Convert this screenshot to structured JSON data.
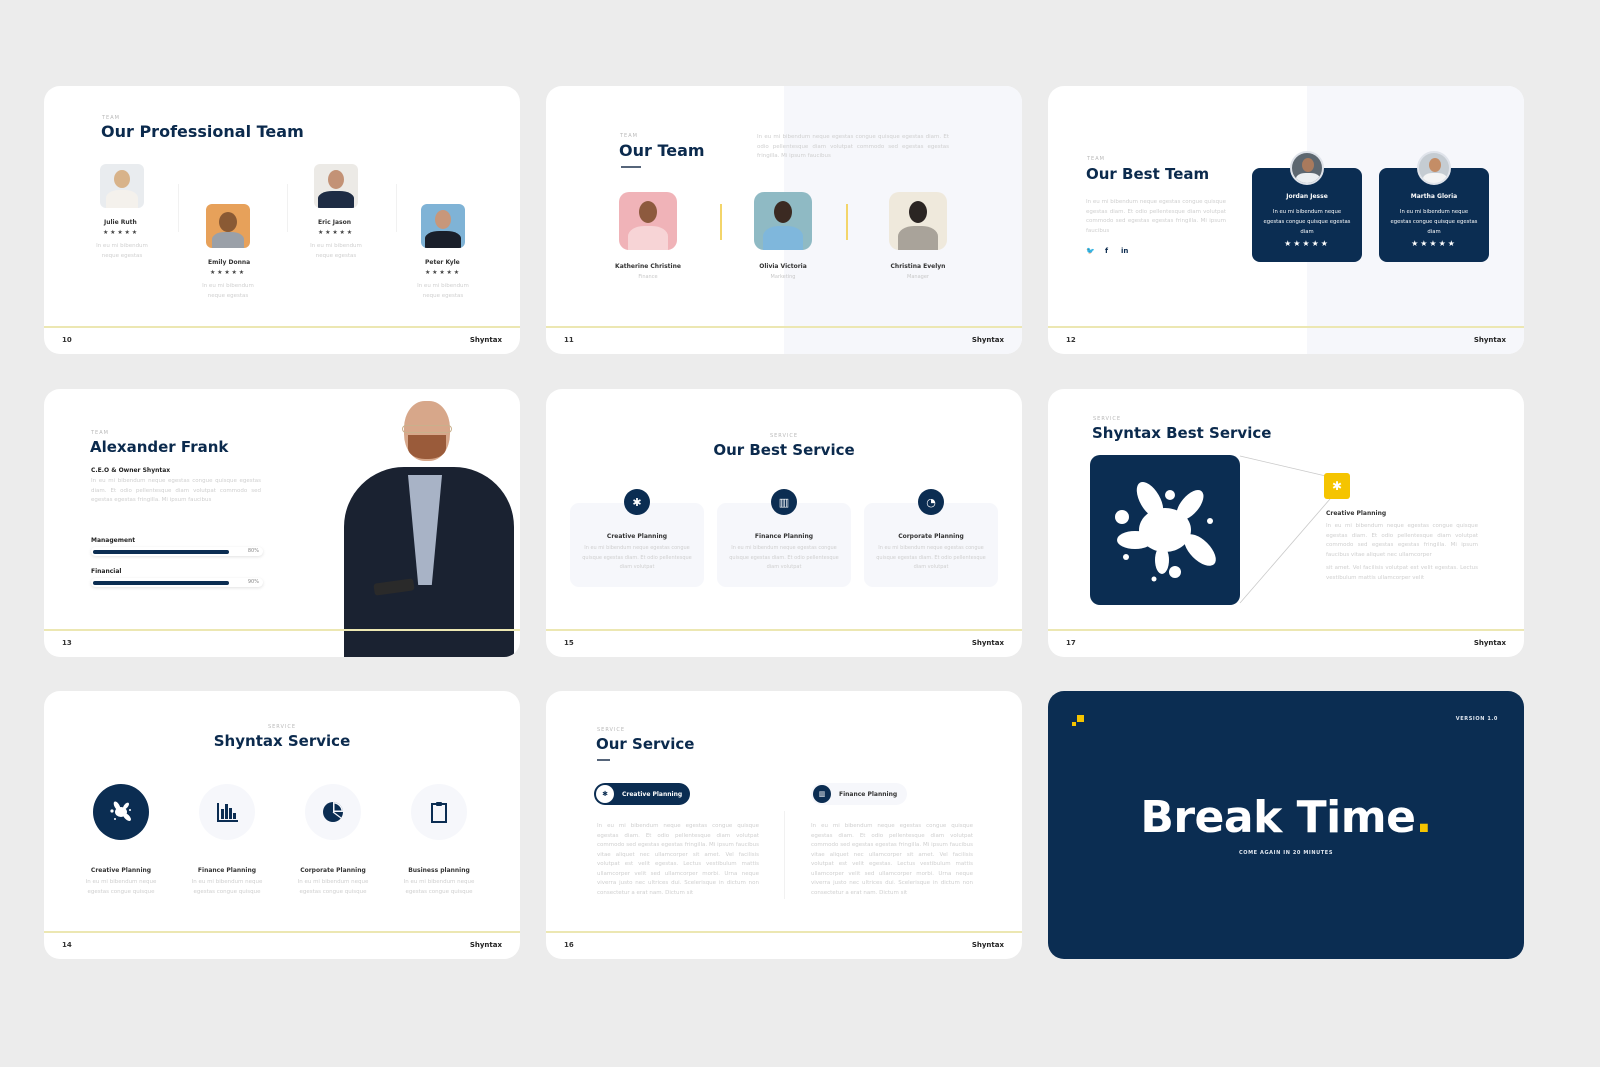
{
  "colors": {
    "navy": "#0b2d52",
    "accent_yellow": "#f5c400",
    "footer_line": "#ece7b2",
    "background": "#ececec"
  },
  "slides": [
    {
      "page": "10",
      "brand": "Shyntax",
      "eyebrow": "TEAM",
      "title": "Our Professional Team",
      "members": [
        {
          "name": "Julie Ruth",
          "stars": "★★★★★",
          "rating": 5,
          "text": "In eu mi bibendum neque egestas"
        },
        {
          "name": "Emily Donna",
          "stars": "★★★★★",
          "rating": 5,
          "text": "In eu mi bibendum neque egestas"
        },
        {
          "name": "Eric Jason",
          "stars": "★★★★★",
          "rating": 5,
          "text": "In eu mi bibendum neque egestas"
        },
        {
          "name": "Peter Kyle",
          "stars": "★★★★★",
          "rating": 5,
          "text": "In eu mi bibendum neque egestas"
        }
      ]
    },
    {
      "page": "11",
      "brand": "Shyntax",
      "eyebrow": "TEAM",
      "title": "Our Team",
      "intro": "In eu mi bibendum neque egestas congue quisque egestas diam. Et odio pellentesque diam volutpat commodo sed egestas egestas fringilla. Mi ipsum faucibus",
      "members": [
        {
          "name": "Katherine  Christine",
          "role": "Finance"
        },
        {
          "name": "Olivia Victoria",
          "role": "Marketing"
        },
        {
          "name": "Christina Evelyn",
          "role": "Manager"
        }
      ]
    },
    {
      "page": "12",
      "brand": "Shyntax",
      "eyebrow": "TEAM",
      "title": "Our Best Team",
      "intro": "In eu mi bibendum neque egestas congue quisque egestas diam. Et odio pellentesque diam volutpat commodo sed egestas egestas fringilla. Mi ipsum faucibus",
      "social": [
        "twitter-icon",
        "facebook-icon",
        "linkedin-icon"
      ],
      "social_glyphs": [
        "🐦",
        "f",
        "in"
      ],
      "members": [
        {
          "name": "Jordan Jesse",
          "text": "In eu mi bibendum neque egestas congue quisque egestas diam",
          "stars": "★★★★★",
          "rating": 5
        },
        {
          "name": "Martha Gloria",
          "text": "In eu mi bibendum neque egestas congue quisque egestas diam",
          "stars": "★★★★★",
          "rating": 5
        }
      ]
    },
    {
      "page": "13",
      "brand": "Shyntax",
      "eyebrow": "TEAM",
      "title": "Alexander Frank",
      "subtitle": "C.E.O & Owner Shyntax",
      "intro": "In eu mi bibendum neque egestas congue quisque egestas diam. Et odio pellentesque diam volutpat commodo sed egestas egestas fringilla. Mi ipsum faucibus",
      "skills": [
        {
          "label": "Management",
          "percent_label": "80%",
          "value": 80
        },
        {
          "label": "Financial",
          "percent_label": "90%",
          "value": 90
        }
      ]
    },
    {
      "page": "15",
      "brand": "Shyntax",
      "eyebrow": "SERVICE",
      "title": "Our Best Service",
      "services": [
        {
          "name": "Creative Planning",
          "icon": "splash-icon",
          "glyph": "✱",
          "text": "In eu mi bibendum neque egestas congue quisque egestas diam. Et odio pellentesque diam volutpat"
        },
        {
          "name": "Finance Planning",
          "icon": "bar-chart-icon",
          "glyph": "▥",
          "text": "In eu mi bibendum neque egestas congue quisque egestas diam. Et odio pellentesque diam volutpat"
        },
        {
          "name": "Corporate Planning",
          "icon": "pie-chart-icon",
          "glyph": "◔",
          "text": "In eu mi bibendum neque egestas congue quisque egestas diam. Et odio pellentesque diam volutpat"
        }
      ]
    },
    {
      "page": "17",
      "brand": "Shyntax",
      "eyebrow": "SERVICE",
      "title": "Shyntax Best Service",
      "feature": {
        "name": "Creative Planning",
        "text1": "In eu mi bibendum neque egestas congue quisque egestas diam. Et odio pellentesque diam volutpat commodo sed egestas egestas fringilla. Mi ipsum faucibus vitae aliquet nec ullamcorper",
        "text2": "sit amet. Vel facilisis volutpat est velit egestas. Lectus vestibulum mattis ullamcorper velit"
      }
    },
    {
      "page": "14",
      "brand": "Shyntax",
      "eyebrow": "SERVICE",
      "title": "Shyntax Service",
      "services": [
        {
          "name": "Creative Planning",
          "icon": "splash-icon",
          "text": "In eu mi bibendum neque egestas congue quisque"
        },
        {
          "name": "Finance Planning",
          "icon": "bar-chart-icon",
          "text": "In eu mi bibendum neque egestas congue quisque"
        },
        {
          "name": "Corporate Planning",
          "icon": "pie-chart-icon",
          "text": "In eu mi bibendum neque egestas congue quisque"
        },
        {
          "name": "Business planning",
          "icon": "clipboard-icon",
          "text": "In eu mi bibendum neque egestas congue quisque"
        }
      ]
    },
    {
      "page": "16",
      "brand": "Shyntax",
      "eyebrow": "SERVICE",
      "title": "Our Service",
      "tabs": [
        {
          "label": "Creative Planning",
          "active": true,
          "glyph": "✱"
        },
        {
          "label": "Finance Planning",
          "active": false,
          "glyph": "▥"
        }
      ],
      "columns": [
        "In eu mi bibendum neque egestas congue quisque egestas diam. Et odio pellentesque diam volutpat commodo sed egestas egestas fringilla. Mi ipsum faucibus vitae aliquet nec ullamcorper sit amet. Vel facilisis volutpat est velit egestas. Lectus vestibulum mattis ullamcorper velit sed ullamcorper morbi. Urna neque viverra justo nec ultrices dui. Scelerisque in dictum non consectetur a erat nam. Dictum sit",
        "In eu mi bibendum neque egestas congue quisque egestas diam. Et odio pellentesque diam volutpat commodo sed egestas egestas fringilla. Mi ipsum faucibus vitae aliquet nec ullamcorper sit amet. Vel facilisis volutpat est velit egestas. Lectus vestibulum mattis ullamcorper velit sed ullamcorper morbi. Urna neque viverra justo nec ultrices dui. Scelerisque in dictum non consectetur a erat nam. Dictum sit"
      ]
    },
    {
      "version": "VERSION 1.0",
      "title": "Break Time",
      "title_dot": ".",
      "subtitle": "COME AGAIN IN 20 MINUTES"
    }
  ]
}
